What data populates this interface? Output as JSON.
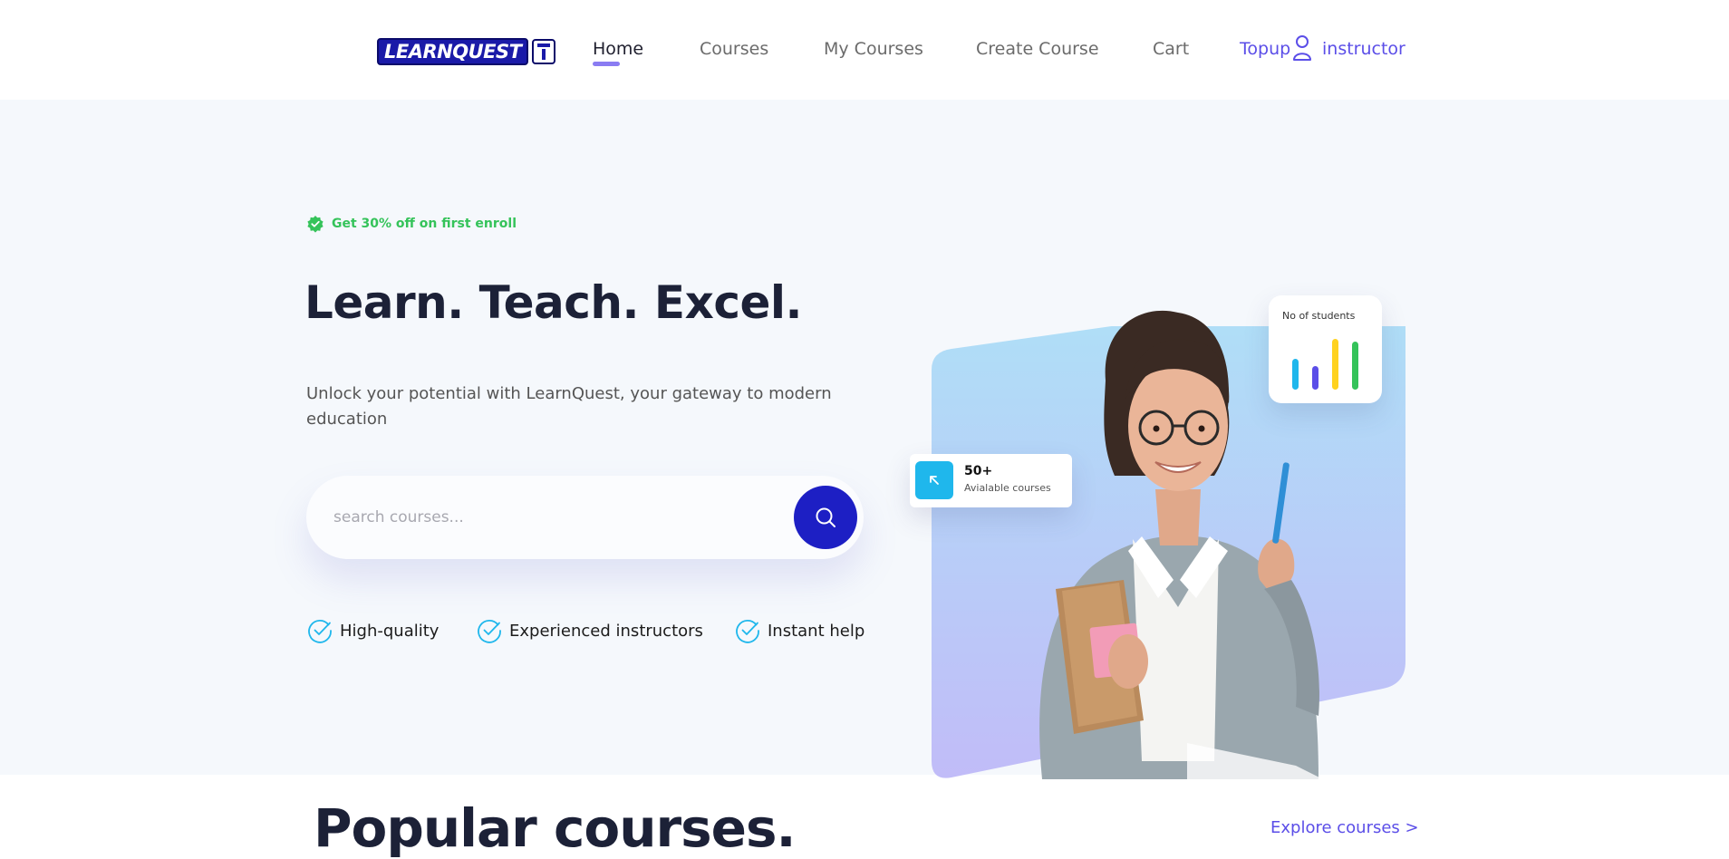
{
  "header": {
    "logo_text": "LEARNQUEST",
    "nav": {
      "home": "Home",
      "courses": "Courses",
      "my_courses": "My Courses",
      "create_course": "Create Course",
      "cart": "Cart",
      "topup": "Topup",
      "instructor": "instructor"
    },
    "icons": {
      "user": "user-icon"
    }
  },
  "hero": {
    "offer_text": "Get 30% off on first enroll",
    "title": "Learn. Teach. Excel.",
    "subtitle": "Unlock your potential with LearnQuest, your gateway to modern education",
    "search": {
      "placeholder": "search courses...",
      "icon": "search-icon"
    },
    "features": [
      "High-quality",
      "Experienced instructors",
      "Instant help"
    ],
    "courses_card": {
      "count": "50+",
      "label": "Avialable courses",
      "icon": "arrow-up-left-icon"
    },
    "students_card": {
      "label": "No of students",
      "bar_levels": [
        0.55,
        0.42,
        0.9,
        0.85
      ]
    }
  },
  "popular": {
    "title": "Popular courses.",
    "explore_link": "Explore courses >"
  },
  "colors": {
    "accent": "#5b4ee8",
    "search_button": "#1d1fc4",
    "offer_green": "#35c35a",
    "check_cyan": "#1fb7ec",
    "hero_bg": "#f5f8fc",
    "title_dark": "#1c2137",
    "bar_colors": [
      "#1fb7ec",
      "#5b4ee8",
      "#ffd21f",
      "#35c35a"
    ]
  }
}
